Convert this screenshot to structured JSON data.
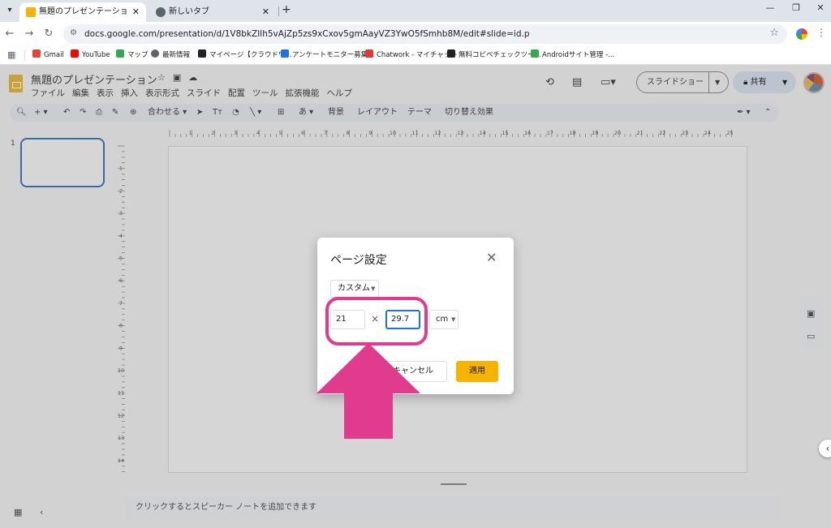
{
  "browser": {
    "tabs": [
      {
        "title": "無題のプレゼンテーション - Google",
        "close": "✕",
        "active": true,
        "icon_color": "#f6b400"
      },
      {
        "title": "新しいタブ",
        "close": "✕",
        "active": false,
        "icon_color": "#5f6368"
      }
    ],
    "new_tab": "+",
    "url": "docs.google.com/presentation/d/1V8bkZIlh5vAjZp5zs9xCxov5gmAayVZ3YwO5fSmhb8M/edit#slide=id.p",
    "bookmarks": [
      {
        "label": "Gmail",
        "icon_color": "#ea4335"
      },
      {
        "label": "YouTube",
        "icon_color": "#ff0000"
      },
      {
        "label": "マップ",
        "icon_color": "#34a853"
      },
      {
        "label": "最新情報",
        "icon_color": "#5f6368"
      },
      {
        "label": "マイページ【クラウドワ...",
        "icon_color": "#202124"
      },
      {
        "label": "アンケートモニター募集...",
        "icon_color": "#1a73e8"
      },
      {
        "label": "Chatwork - マイチャット",
        "icon_color": "#e53935"
      },
      {
        "label": "無料コピペチェックツー...",
        "icon_color": "#202124"
      },
      {
        "label": "Androidサイト管理 -...",
        "icon_color": "#34a853"
      }
    ]
  },
  "app": {
    "doc_title": "無題のプレゼンテーション",
    "menu": [
      "ファイル",
      "編集",
      "表示",
      "挿入",
      "表示形式",
      "スライド",
      "配置",
      "ツール",
      "拡張機能",
      "ヘルプ"
    ],
    "slideshow_label": "スライドショー",
    "share_label": "共有",
    "toolbar": {
      "zoom": "合わせる",
      "background": "背景",
      "layout": "レイアウト",
      "theme": "テーマ",
      "transition": "切り替え効果"
    },
    "slide_number": "1",
    "notes_placeholder": "クリックするとスピーカー ノートを追加できます",
    "ruler_h_labels": [
      "1",
      "2",
      "3",
      "4",
      "5",
      "6",
      "7",
      "8",
      "9",
      "10",
      "11",
      "12",
      "13",
      "14",
      "15",
      "16",
      "17",
      "18",
      "19",
      "20",
      "21",
      "22",
      "23",
      "24",
      "25"
    ],
    "ruler_v_labels": [
      "1",
      "2",
      "3",
      "4",
      "5",
      "6",
      "7",
      "8",
      "9",
      "10",
      "11",
      "12",
      "13",
      "14"
    ]
  },
  "dialog": {
    "title": "ページ設定",
    "close": "✕",
    "preset": "カスタム",
    "width_value": "21",
    "times": "×",
    "height_value": "29.7",
    "unit": "cm",
    "cancel": "キャンセル",
    "apply": "適用"
  },
  "colors": {
    "highlight": "#e03b8d",
    "apply_button": "#f6b400",
    "focus": "#1a73e8"
  }
}
